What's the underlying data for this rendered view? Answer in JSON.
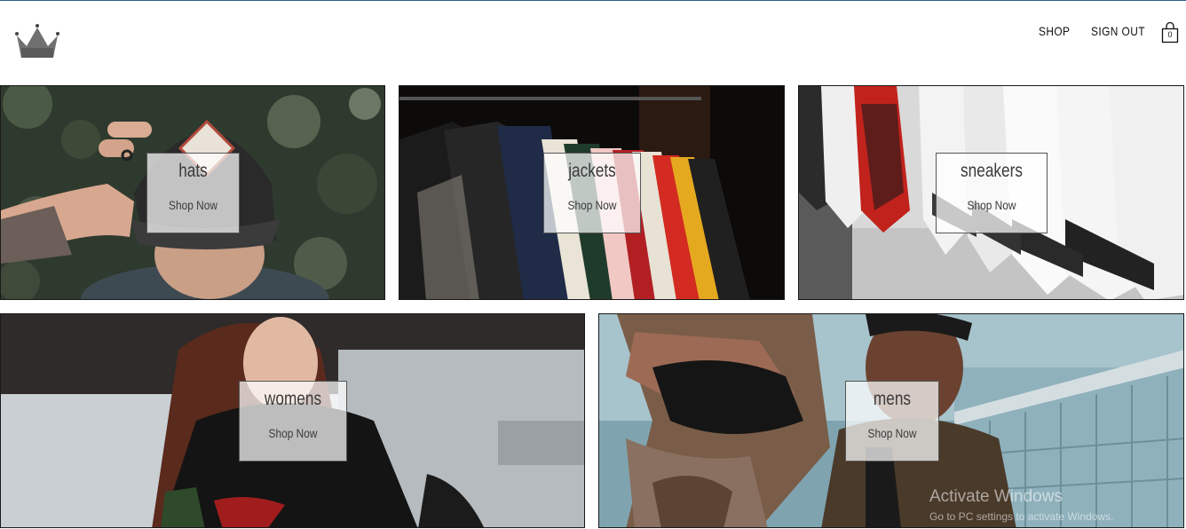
{
  "header": {
    "nav": {
      "shop_label": "SHOP",
      "signout_label": "SIGN OUT"
    },
    "cart": {
      "count": "0"
    }
  },
  "directory": {
    "sections": [
      {
        "title": "hats",
        "subtitle": "Shop Now"
      },
      {
        "title": "jackets",
        "subtitle": "Shop Now"
      },
      {
        "title": "sneakers",
        "subtitle": "Shop Now"
      },
      {
        "title": "womens",
        "subtitle": "Shop Now"
      },
      {
        "title": "mens",
        "subtitle": "Shop Now"
      }
    ]
  },
  "os_watermark": {
    "line1": "Activate Windows",
    "line2": "Go to PC settings to activate Windows."
  },
  "colors": {
    "accent_line": "#2d5b8a",
    "tile_border": "#1a1a1a"
  }
}
